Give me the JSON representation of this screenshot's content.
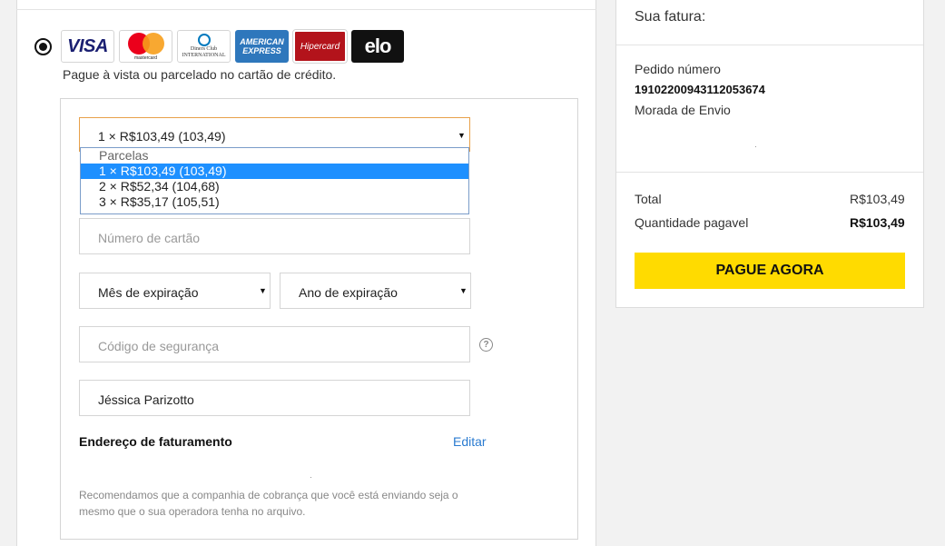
{
  "payment": {
    "cards": {
      "visa": "VISA",
      "mastercard": "mastercard",
      "diners": [
        "Diners Club",
        "INTERNATIONAL"
      ],
      "amex": [
        "AMERICAN",
        "EXPRESS"
      ],
      "hipercard": "Hipercard",
      "elo": "elo"
    },
    "subtitle": "Pague à vista ou parcelado no cartão de crédito."
  },
  "form": {
    "installments_selected": "1 × R$103,49 (103,49)",
    "installments_options": {
      "header": "Parcelas",
      "items": [
        "1 × R$103,49 (103,49)",
        "2 × R$52,34 (104,68)",
        "3 × R$35,17 (105,51)"
      ]
    },
    "card_number_placeholder": "Número de cartão",
    "exp_month": "Mês de expiração",
    "exp_year": "Ano de expiração",
    "security_code_placeholder": "Código de segurança",
    "help_icon_glyph": "?",
    "cardholder_name": "Jéssica Parizotto",
    "billing_title": "Endereço de faturamento",
    "edit_label": "Editar",
    "note": "Recomendamos que a companhia de cobrança que você está enviando seja o mesmo que o sua operadora tenha no arquivo."
  },
  "invoice": {
    "title": "Sua fatura:",
    "order_label": "Pedido número",
    "order_number": "19102200943112053674",
    "shipping_label": "Morada de Envio",
    "total_label": "Total",
    "total_value": "R$103,49",
    "payable_label": "Quantidade pagavel",
    "payable_value": "R$103,49",
    "pay_button": "PAGUE AGORA"
  },
  "colors": {
    "accent_yellow": "#ffdb00",
    "link_blue": "#2a7bd0",
    "selected_blue": "#1e90ff",
    "focus_orange": "#e8a14a"
  }
}
